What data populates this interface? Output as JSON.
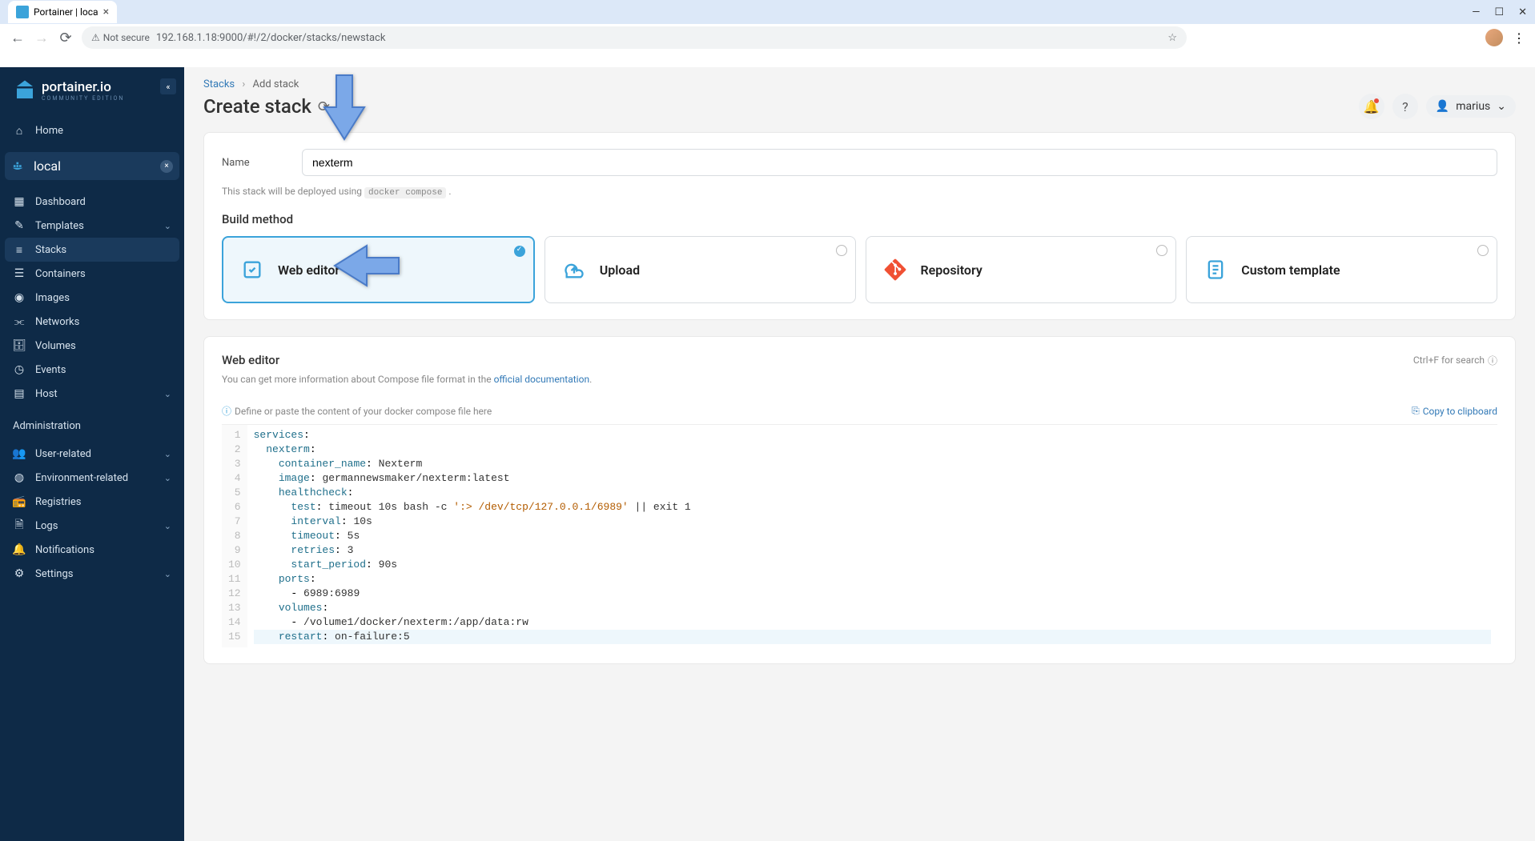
{
  "browser": {
    "tab_title": "Portainer | loca",
    "url": "192.168.1.18:9000/#!/2/docker/stacks/newstack",
    "not_secure": "Not secure"
  },
  "sidebar": {
    "logo": "portainer.io",
    "logo_sub": "COMMUNITY EDITION",
    "home": "Home",
    "env": "local",
    "items": [
      {
        "label": "Dashboard",
        "icon": "grid"
      },
      {
        "label": "Templates",
        "icon": "edit",
        "chevron": true
      },
      {
        "label": "Stacks",
        "icon": "layers",
        "active": true
      },
      {
        "label": "Containers",
        "icon": "list"
      },
      {
        "label": "Images",
        "icon": "disc"
      },
      {
        "label": "Networks",
        "icon": "share"
      },
      {
        "label": "Volumes",
        "icon": "db"
      },
      {
        "label": "Events",
        "icon": "clock"
      },
      {
        "label": "Host",
        "icon": "server",
        "chevron": true
      }
    ],
    "admin_title": "Administration",
    "admin_items": [
      {
        "label": "User-related",
        "icon": "users",
        "chevron": true
      },
      {
        "label": "Environment-related",
        "icon": "globe",
        "chevron": true
      },
      {
        "label": "Registries",
        "icon": "radio"
      },
      {
        "label": "Logs",
        "icon": "file",
        "chevron": true
      },
      {
        "label": "Notifications",
        "icon": "bell"
      },
      {
        "label": "Settings",
        "icon": "gear",
        "chevron": true
      }
    ]
  },
  "header": {
    "breadcrumb_root": "Stacks",
    "breadcrumb_current": "Add stack",
    "title": "Create stack",
    "user": "marius"
  },
  "form": {
    "name_label": "Name",
    "name_value": "nexterm",
    "deploy_hint_pre": "This stack will be deployed using ",
    "deploy_hint_code": "docker compose",
    "build_label": "Build method",
    "methods": [
      {
        "label": "Web editor",
        "selected": true
      },
      {
        "label": "Upload"
      },
      {
        "label": "Repository"
      },
      {
        "label": "Custom template"
      }
    ]
  },
  "editor": {
    "title": "Web editor",
    "shortcut": "Ctrl+F for search",
    "sub_pre": "You can get more information about Compose file format in the ",
    "sub_link": "official documentation",
    "placeholder": "Define or paste the content of your docker compose file here",
    "copy": "Copy to clipboard",
    "lines": [
      "services:",
      "  nexterm:",
      "    container_name: Nexterm",
      "    image: germannewsmaker/nexterm:latest",
      "    healthcheck:",
      "      test: timeout 10s bash -c ':> /dev/tcp/127.0.0.1/6989' || exit 1",
      "      interval: 10s",
      "      timeout: 5s",
      "      retries: 3",
      "      start_period: 90s",
      "    ports:",
      "      - 6989:6989",
      "    volumes:",
      "      - /volume1/docker/nexterm:/app/data:rw",
      "    restart: on-failure:5"
    ]
  }
}
